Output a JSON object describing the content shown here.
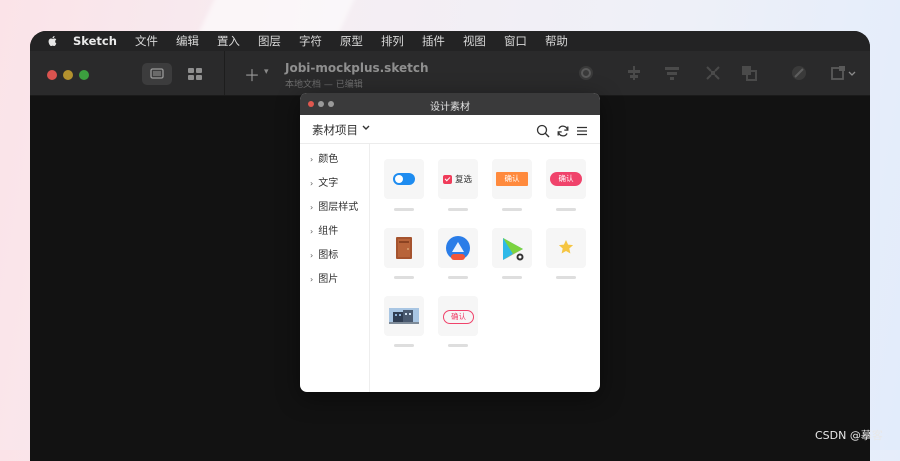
{
  "menubar": {
    "app_name": "Sketch",
    "items": [
      "文件",
      "编辑",
      "置入",
      "图层",
      "字符",
      "原型",
      "排列",
      "插件",
      "视图",
      "窗口",
      "帮助"
    ]
  },
  "toolbar": {
    "doc_title": "Jobi-mockplus.sketch",
    "doc_subtitle": "本地文档 — 已编辑"
  },
  "panel": {
    "title": "设计素材",
    "project_selector": "素材项目",
    "categories": [
      "颜色",
      "文字",
      "图层样式",
      "组件",
      "图标",
      "图片"
    ],
    "assets": {
      "checkbox_text": "复选",
      "confirm_orange": "确认",
      "confirm_pink": "确认",
      "confirm_outline": "确认"
    }
  },
  "icons": [
    "apple-icon",
    "search-icon",
    "refresh-icon",
    "menu-icon",
    "plus-icon",
    "chevron-down-icon"
  ],
  "colors": {
    "accent_blue": "#1e8cf0",
    "accent_pink": "#f0436b",
    "accent_orange": "#ff8a3d",
    "star_yellow": "#f5c542"
  },
  "watermark": "CSDN @摹客"
}
